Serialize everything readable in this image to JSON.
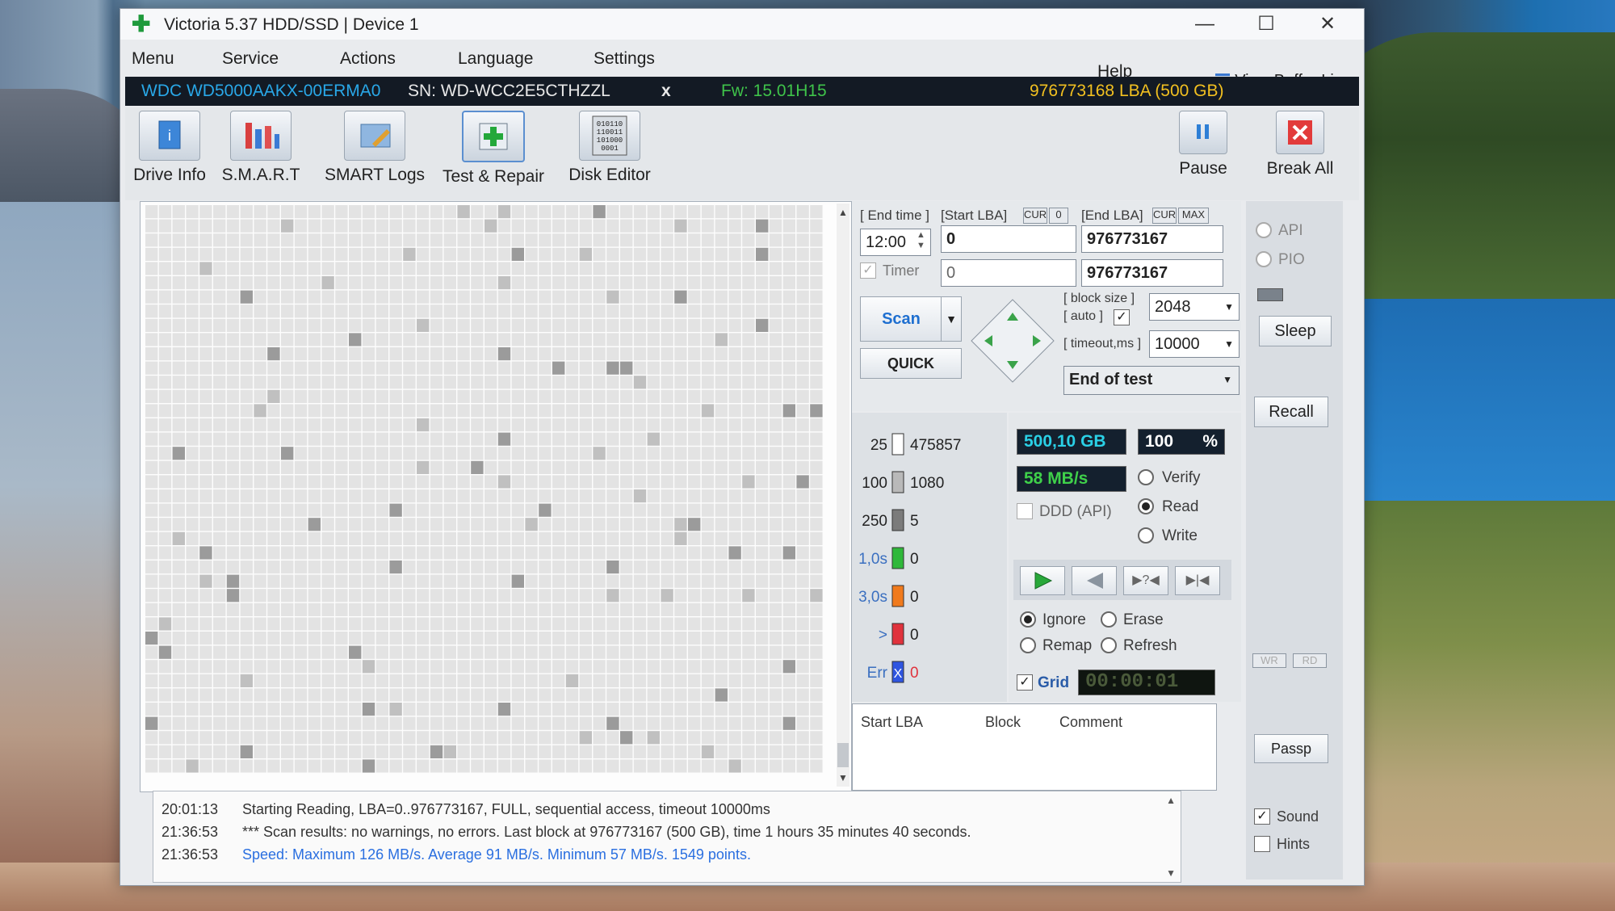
{
  "window": {
    "title": "Victoria 5.37 HDD/SSD | Device 1",
    "controls": {
      "minimize": "—",
      "maximize": "☐",
      "close": "✕"
    }
  },
  "menu": {
    "items": [
      "Menu",
      "Service",
      "Actions",
      "Language",
      "Settings"
    ],
    "help": "Help",
    "view_buffer": "View Buffer Live"
  },
  "device": {
    "model": "WDC WD5000AAKX-00ERMA0",
    "serial": "SN: WD-WCC2E5CTHZZL",
    "close": "x",
    "firmware": "Fw: 15.01H15",
    "lba": "976773168 LBA (500 GB)"
  },
  "toolbar": {
    "drive_info": "Drive Info",
    "smart": "S.M.A.R.T",
    "smart_logs": "SMART Logs",
    "test_repair": "Test & Repair",
    "disk_editor": "Disk Editor",
    "pause": "Pause",
    "break_all": "Break All",
    "disk_editor_glyph": "010110\n110011\n101000\n0001"
  },
  "test": {
    "end_time_label": "[ End time ]",
    "end_time": "12:00",
    "start_lba_label": "[Start LBA]",
    "cur": "CUR",
    "zero": "0",
    "end_lba_label": "[End LBA]",
    "max": "MAX",
    "start_lba": "0",
    "end_lba": "976773167",
    "timer_label": "Timer",
    "timer_value": "0",
    "timer_end": "976773167",
    "scan_button": "Scan",
    "quick_button": "QUICK",
    "block_size_label": "[ block size ]",
    "auto_label": "[ auto ]",
    "block_size": "2048",
    "timeout_label": "[ timeout,ms ]",
    "timeout": "10000",
    "end_action": "End of test"
  },
  "stats": {
    "legend": [
      {
        "label": "25",
        "count": "475857",
        "color": "#ffffff"
      },
      {
        "label": "100",
        "count": "1080",
        "color": "#b9b9b9"
      },
      {
        "label": "250",
        "count": "5",
        "color": "#7b7b7b"
      },
      {
        "label": "1,0s",
        "count": "0",
        "color": "#2fb83a"
      },
      {
        "label": "3,0s",
        "count": "0",
        "color": "#f07a1c"
      },
      {
        "label": ">",
        "count": "0",
        "color": "#e0323c"
      },
      {
        "label": "Err",
        "count": "0",
        "color": "#2f55e0"
      }
    ],
    "size": "500,10 GB",
    "percent": "100",
    "percent_sign": "%",
    "speed": "58 MB/s",
    "ddd_api": "DDD (API)",
    "verify": "Verify",
    "read": "Read",
    "write": "Write",
    "ignore": "Ignore",
    "erase": "Erase",
    "remap": "Remap",
    "refresh": "Refresh",
    "grid": "Grid",
    "timer_display": "00:00:01",
    "err_x": "X"
  },
  "table": {
    "col_start": "Start LBA",
    "col_block": "Block",
    "col_comment": "Comment"
  },
  "side": {
    "api": "API",
    "pio": "PIO",
    "sleep": "Sleep",
    "recall": "Recall",
    "wr": "WR",
    "rd": "RD",
    "passp": "Passp",
    "sound": "Sound",
    "hints": "Hints"
  },
  "log": [
    {
      "time": "20:01:13",
      "text": "Starting Reading, LBA=0..976773167, FULL, sequential access, timeout 10000ms",
      "color": "#333333"
    },
    {
      "time": "21:36:53",
      "text": "*** Scan results: no warnings, no errors. Last block at 976773167 (500 GB), time 1 hours 35 minutes 40 seconds.",
      "color": "#333333"
    },
    {
      "time": "21:36:53",
      "text": "Speed: Maximum 126 MB/s. Average 91 MB/s. Minimum 57 MB/s. 1549 points.",
      "color": "#2a6fe0"
    }
  ]
}
